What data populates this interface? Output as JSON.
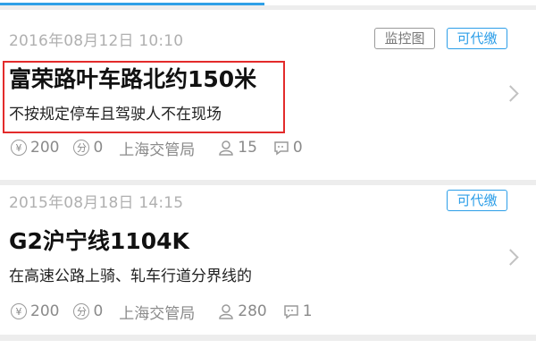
{
  "violations": [
    {
      "date": "2016年08月12日 10:10",
      "tags": [
        {
          "label": "监控图",
          "style": "gray"
        },
        {
          "label": "可代缴",
          "style": "blue"
        }
      ],
      "location": "富荣路叶车路北约150米",
      "description": "不按规定停车且驾驶人不在现场",
      "fine": "200",
      "points": "0",
      "authority": "上海交管局",
      "followers": "15",
      "comments": "0",
      "highlighted": true
    },
    {
      "date": "2015年08月18日 14:15",
      "tags": [
        {
          "label": "可代缴",
          "style": "blue"
        }
      ],
      "location": "G2沪宁线1104K",
      "description": "在高速公路上骑、轧车行道分界线的",
      "fine": "200",
      "points": "0",
      "authority": "上海交管局",
      "followers": "280",
      "comments": "1",
      "highlighted": false
    }
  ],
  "icons": {
    "fine": "yen-circle-icon",
    "points": "points-circle-icon",
    "followers": "person-icon",
    "comments": "comment-icon",
    "open": "chevron-right-icon"
  },
  "colors": {
    "accent": "#2c9ee8",
    "highlight": "#e32b2b",
    "background": "#ededed"
  }
}
